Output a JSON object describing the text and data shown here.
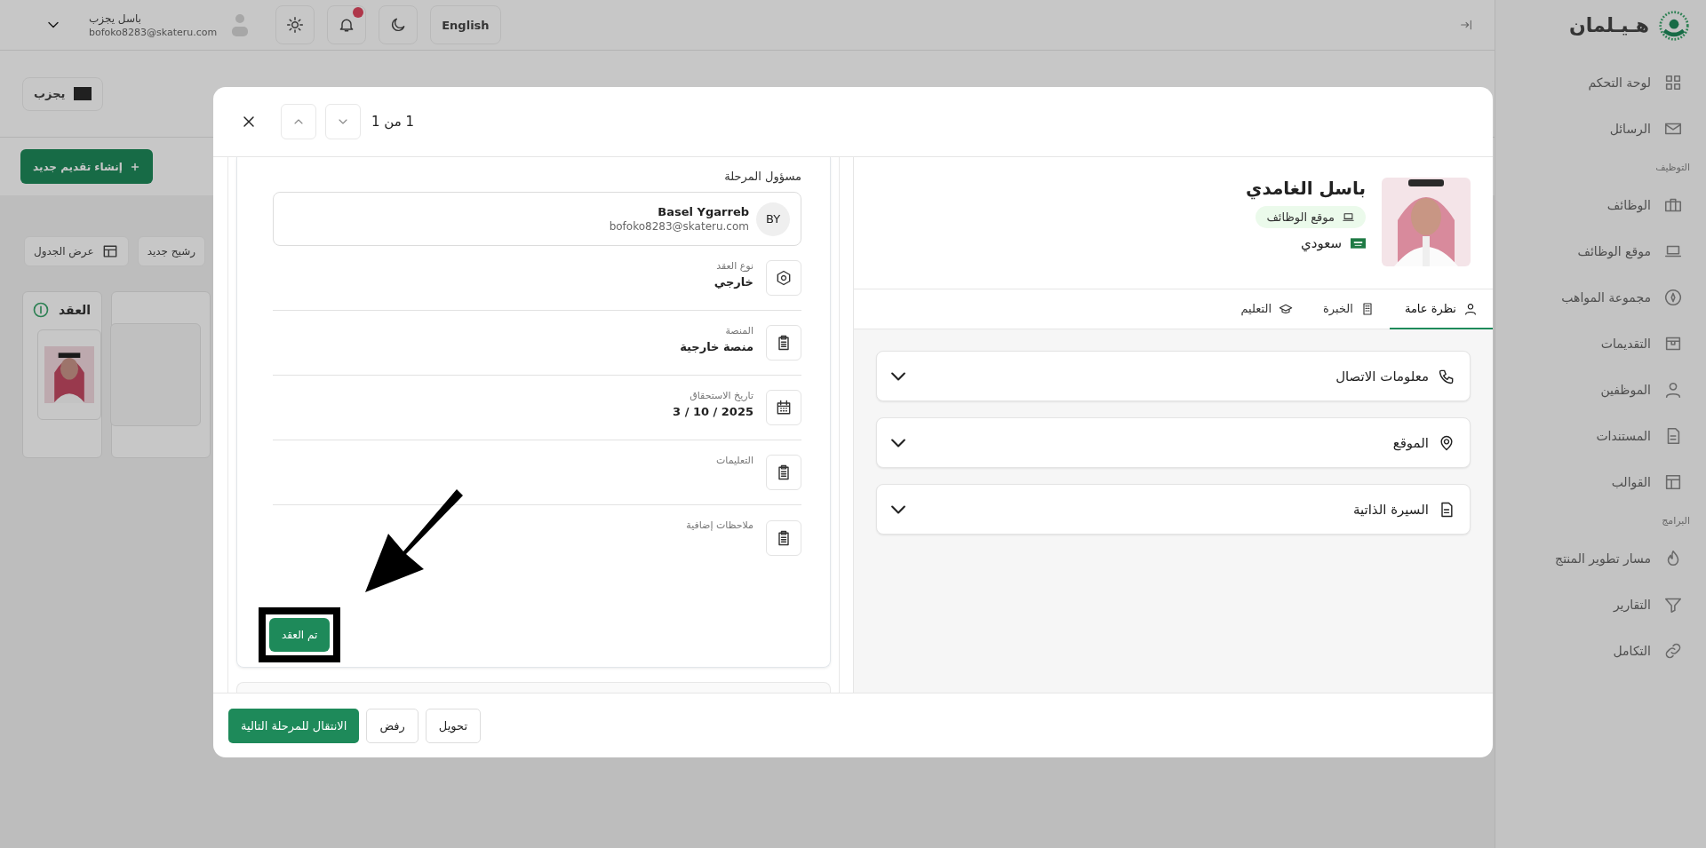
{
  "sidebar": {
    "logo": "هـيـلمان",
    "groups": [
      {
        "items": [
          {
            "label": "لوحة التحكم",
            "selected": false
          },
          {
            "label": "الرسائل",
            "selected": false
          }
        ]
      },
      {
        "title": "التوظيف",
        "items": [
          {
            "label": "الوظائف",
            "selected": false
          },
          {
            "label": "موقع الوظائف",
            "selected": false
          },
          {
            "label": "مجموعة المواهب",
            "selected": false
          },
          {
            "label": "التقديمات",
            "selected": false
          },
          {
            "label": "الموظفين",
            "selected": false
          },
          {
            "label": "المستندات",
            "selected": false
          },
          {
            "label": "القوالب",
            "selected": false
          }
        ]
      },
      {
        "title": "البرامج",
        "items": [
          {
            "label": "مسار تطوير المنتج",
            "selected": false
          },
          {
            "label": "التقارير",
            "selected": false
          },
          {
            "label": "التكامل",
            "selected": false
          }
        ]
      }
    ]
  },
  "topbar": {
    "language": "English",
    "user": {
      "name": "باسل يجزب",
      "email": "bofoko8283@skateru.com"
    }
  },
  "main": {
    "company_button": "يجزب",
    "create_button": "إنشاء تقديم جديد",
    "toolbar": [
      "رشيح جديد",
      "عرض الجدول"
    ],
    "columns": [
      {
        "title": "العقد"
      }
    ]
  },
  "modal": {
    "pager": "1 من 1",
    "stage_owner": {
      "label": "مسؤول المرحلة",
      "initials": "BY",
      "name": "Basel Ygarreb",
      "email": "bofoko8283@skateru.com"
    },
    "details": [
      {
        "label": "نوع العقد",
        "value": "خارجي"
      },
      {
        "label": "المنصة",
        "value": "منصة خارجية"
      },
      {
        "label": "تاريخ الاستحقاق",
        "value": "3 / 10 / 2025"
      },
      {
        "label": "التعليمات"
      },
      {
        "label": "ملاحظات إضافية"
      }
    ],
    "action_button": "تم العقد",
    "footer_buttons": [
      {
        "label": "تحويل",
        "kind": "outline"
      },
      {
        "label": "رفض",
        "kind": "outline"
      },
      {
        "label": "الانتقال للمرحلة التالية",
        "kind": "primary"
      }
    ],
    "profile": {
      "name": "باسل الغامدي",
      "source": "موقع الوظائف",
      "nationality": "سعودي"
    },
    "tabs": [
      {
        "label": "نظرة عامة",
        "selected": true
      },
      {
        "label": "الخبرة",
        "selected": false
      },
      {
        "label": "التعليم",
        "selected": false
      }
    ],
    "sections": [
      {
        "title": "معلومات الاتصال",
        "expanded": false
      },
      {
        "title": "الموقع",
        "expanded": false
      },
      {
        "title": "السيرة الذاتية",
        "expanded": false
      }
    ]
  }
}
